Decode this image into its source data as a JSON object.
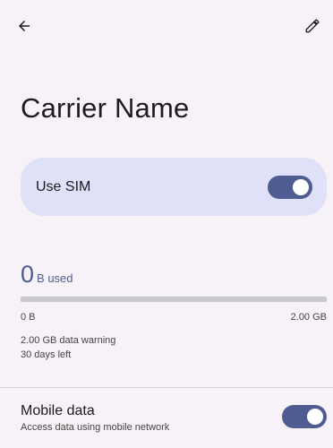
{
  "page": {
    "title": "Carrier Name"
  },
  "sim": {
    "label": "Use SIM",
    "enabled": true
  },
  "usage": {
    "amount": "0",
    "unit": "B used",
    "fraction_used": 0,
    "scale_min": "0 B",
    "scale_max": "2.00 GB",
    "warning": "2.00 GB data warning",
    "days_left": "30 days left"
  },
  "mobile_data": {
    "title": "Mobile data",
    "subtitle": "Access data using mobile network",
    "enabled": true
  },
  "icons": {
    "back": "arrow-back-icon",
    "edit": "pencil-edit-icon"
  },
  "colors": {
    "background": "#f7f2f7",
    "accent": "#4f5c92",
    "sim_card": "#dfe1f8"
  }
}
